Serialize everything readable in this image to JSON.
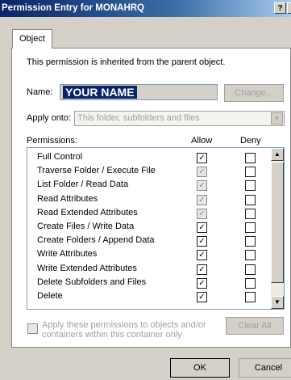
{
  "window": {
    "title": "Permission Entry for MONAHRQ",
    "help_label": "?",
    "close_label": "x"
  },
  "tabs": [
    {
      "label": "Object",
      "selected": true
    }
  ],
  "inherited_message": "This permission is inherited from the parent object.",
  "name": {
    "label": "Name:",
    "value": "YOUR NAME",
    "change_label": "Change..."
  },
  "apply_onto": {
    "label": "Apply onto:",
    "value": "This folder, subfolders and files"
  },
  "permissions": {
    "label": "Permissions:",
    "allow_header": "Allow",
    "deny_header": "Deny",
    "items": [
      {
        "label": "Full Control",
        "allow": true,
        "allow_enabled": true,
        "deny": false
      },
      {
        "label": "Traverse Folder / Execute File",
        "allow": true,
        "allow_enabled": false,
        "deny": false
      },
      {
        "label": "List Folder / Read Data",
        "allow": true,
        "allow_enabled": false,
        "deny": false
      },
      {
        "label": "Read Attributes",
        "allow": true,
        "allow_enabled": false,
        "deny": false
      },
      {
        "label": "Read Extended Attributes",
        "allow": true,
        "allow_enabled": false,
        "deny": false
      },
      {
        "label": "Create Files / Write Data",
        "allow": true,
        "allow_enabled": true,
        "deny": false
      },
      {
        "label": "Create Folders / Append Data",
        "allow": true,
        "allow_enabled": true,
        "deny": false
      },
      {
        "label": "Write Attributes",
        "allow": true,
        "allow_enabled": true,
        "deny": false
      },
      {
        "label": "Write Extended Attributes",
        "allow": true,
        "allow_enabled": true,
        "deny": false
      },
      {
        "label": "Delete Subfolders and Files",
        "allow": true,
        "allow_enabled": true,
        "deny": false
      },
      {
        "label": "Delete",
        "allow": true,
        "allow_enabled": true,
        "deny": false
      }
    ]
  },
  "apply_to_container": {
    "label": "Apply these permissions to objects and/or containers within this container only",
    "checked": false
  },
  "buttons": {
    "clear_all": "Clear All",
    "ok": "OK",
    "cancel": "Cancel"
  }
}
